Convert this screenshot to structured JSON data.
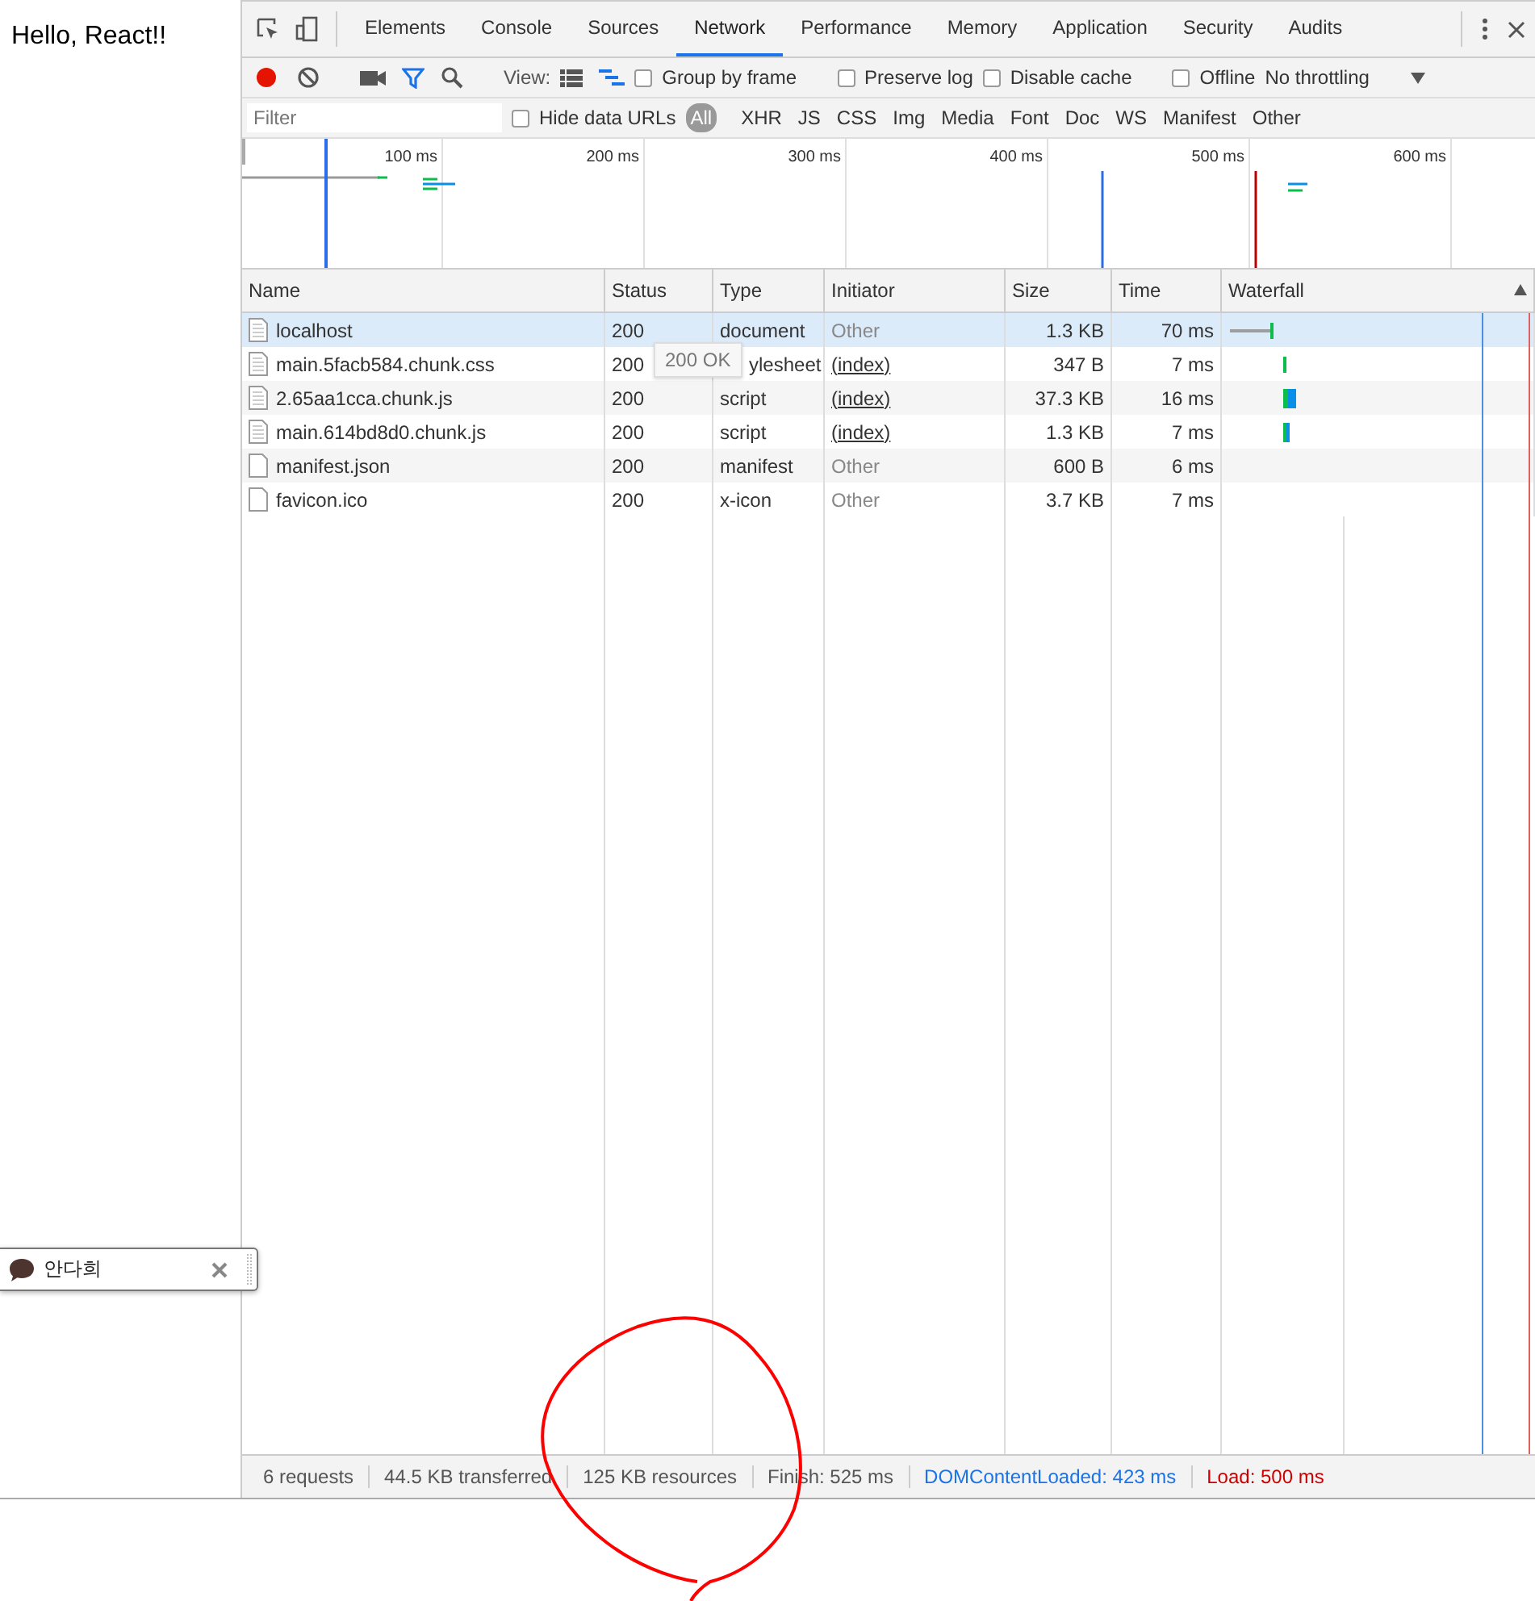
{
  "page": {
    "heading": "Hello, React!!"
  },
  "chat_widget": {
    "name": "안다희"
  },
  "devtools": {
    "tabs": [
      {
        "label": "Elements",
        "selected": false
      },
      {
        "label": "Console",
        "selected": false
      },
      {
        "label": "Sources",
        "selected": false
      },
      {
        "label": "Network",
        "selected": true
      },
      {
        "label": "Performance",
        "selected": false
      },
      {
        "label": "Memory",
        "selected": false
      },
      {
        "label": "Application",
        "selected": false
      },
      {
        "label": "Security",
        "selected": false
      },
      {
        "label": "Audits",
        "selected": false
      }
    ],
    "toolbar": {
      "recording": true,
      "view_label": "View:",
      "checkboxes": [
        {
          "label": "Group by frame",
          "checked": false
        },
        {
          "label": "Preserve log",
          "checked": false
        },
        {
          "label": "Disable cache",
          "checked": false
        },
        {
          "label": "Offline",
          "checked": false
        }
      ],
      "throttling": "No throttling"
    },
    "filter_bar": {
      "placeholder": "Filter",
      "hide_data_urls": {
        "label": "Hide data URLs",
        "checked": false
      },
      "types": [
        {
          "label": "All",
          "selected": true
        },
        {
          "label": "XHR",
          "selected": false
        },
        {
          "label": "JS",
          "selected": false
        },
        {
          "label": "CSS",
          "selected": false
        },
        {
          "label": "Img",
          "selected": false
        },
        {
          "label": "Media",
          "selected": false
        },
        {
          "label": "Font",
          "selected": false
        },
        {
          "label": "Doc",
          "selected": false
        },
        {
          "label": "WS",
          "selected": false
        },
        {
          "label": "Manifest",
          "selected": false
        },
        {
          "label": "Other",
          "selected": false
        }
      ]
    },
    "overview": {
      "ticks": [
        "100 ms",
        "200 ms",
        "300 ms",
        "400 ms",
        "500 ms",
        "600 ms"
      ]
    },
    "table": {
      "columns": [
        "Name",
        "Status",
        "Type",
        "Initiator",
        "Size",
        "Time",
        "Waterfall"
      ],
      "rows": [
        {
          "name": "localhost",
          "status": "200",
          "type": "document",
          "initiator": "Other",
          "initiator_underlined": false,
          "size": "1.3 KB",
          "time": "70 ms",
          "selected": true
        },
        {
          "name": "main.5facb584.chunk.css",
          "status": "200",
          "type": "ylesheet",
          "initiator": "(index)",
          "initiator_underlined": true,
          "size": "347 B",
          "time": "7 ms",
          "selected": false
        },
        {
          "name": "2.65aa1cca.chunk.js",
          "status": "200",
          "type": "script",
          "initiator": "(index)",
          "initiator_underlined": true,
          "size": "37.3 KB",
          "time": "16 ms",
          "selected": false
        },
        {
          "name": "main.614bd8d0.chunk.js",
          "status": "200",
          "type": "script",
          "initiator": "(index)",
          "initiator_underlined": true,
          "size": "1.3 KB",
          "time": "7 ms",
          "selected": false
        },
        {
          "name": "manifest.json",
          "status": "200",
          "type": "manifest",
          "initiator": "Other",
          "initiator_underlined": false,
          "size": "600 B",
          "time": "6 ms",
          "selected": false
        },
        {
          "name": "favicon.ico",
          "status": "200",
          "type": "x-icon",
          "initiator": "Other",
          "initiator_underlined": false,
          "size": "3.7 KB",
          "time": "7 ms",
          "selected": false
        }
      ]
    },
    "tooltip": "200 OK",
    "summary": [
      {
        "text": "6 requests",
        "kind": "plain"
      },
      {
        "text": "44.5 KB transferred",
        "kind": "plain"
      },
      {
        "text": "125 KB resources",
        "kind": "plain"
      },
      {
        "text": "Finish: 525 ms",
        "kind": "plain"
      },
      {
        "text": "DOMContentLoaded: 423 ms",
        "kind": "dom"
      },
      {
        "text": "Load: 500 ms",
        "kind": "load"
      }
    ]
  }
}
